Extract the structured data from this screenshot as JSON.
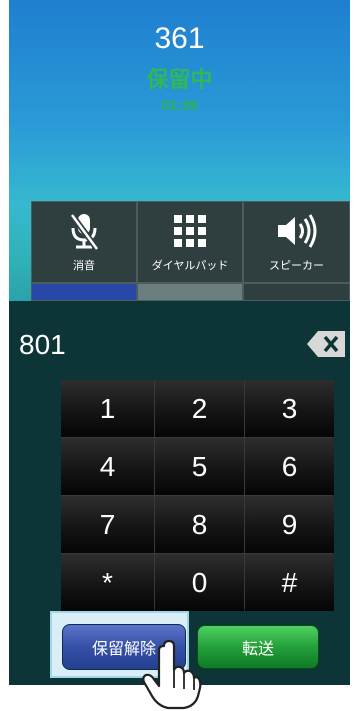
{
  "call": {
    "number": "361",
    "status": "保留中",
    "timer": "01:39"
  },
  "functions": [
    {
      "label": "消音",
      "icon": "mic-off-icon"
    },
    {
      "label": "ダイヤルパッド",
      "icon": "dialpad-icon"
    },
    {
      "label": "スピーカー",
      "icon": "speaker-icon"
    }
  ],
  "dialer": {
    "entered_number": "801",
    "backspace_icon": "backspace-icon",
    "keys": [
      "1",
      "2",
      "3",
      "4",
      "5",
      "6",
      "7",
      "8",
      "9",
      "*",
      "0",
      "#"
    ]
  },
  "actions": {
    "hold_release_label": "保留解除",
    "transfer_label": "転送"
  },
  "colors": {
    "status_green": "#2fb85a",
    "hold_button_blue": "#3650a8",
    "transfer_button_green": "#24a03a",
    "dialer_background": "#0d3436"
  }
}
